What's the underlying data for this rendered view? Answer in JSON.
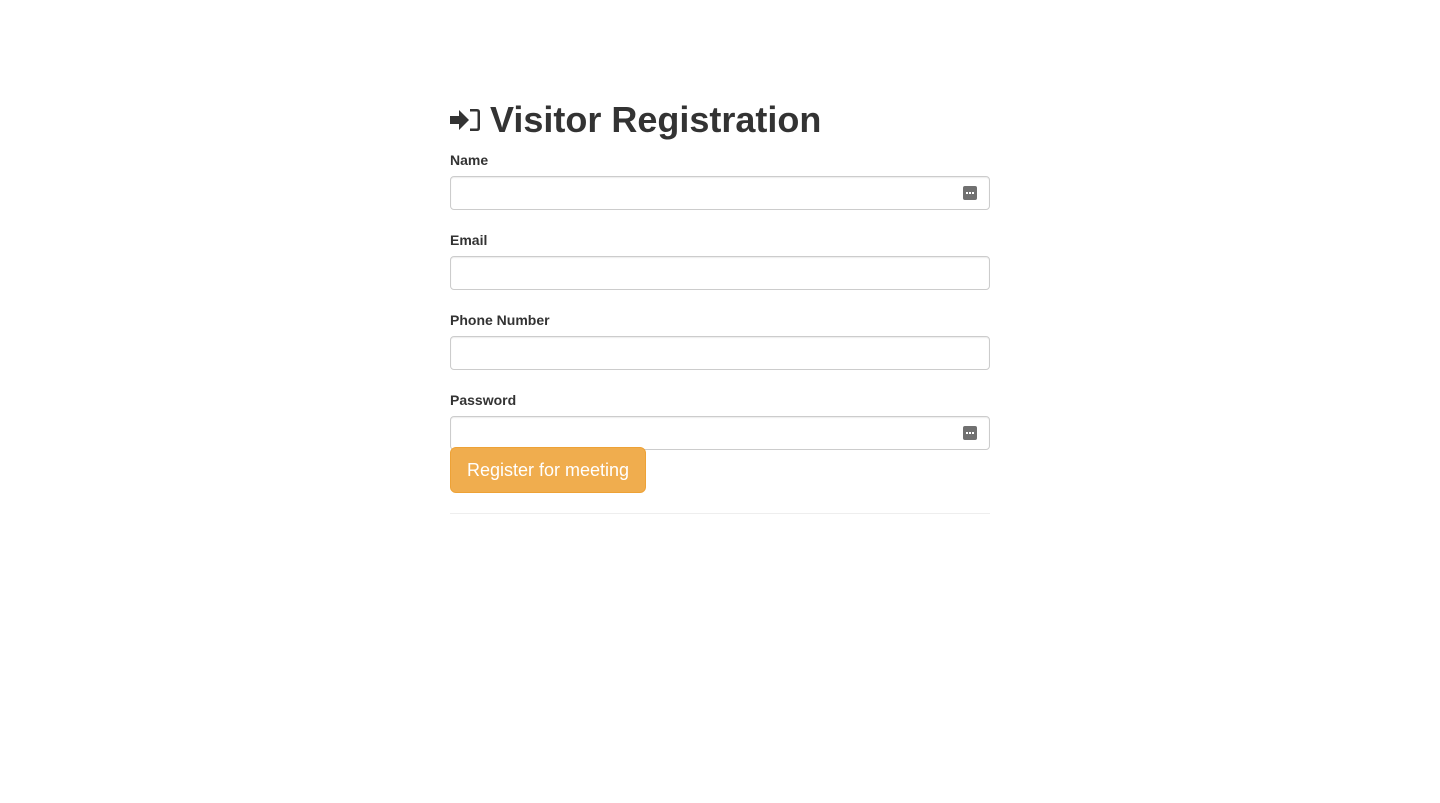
{
  "header": {
    "icon": "sign-in-icon",
    "title": "Visitor Registration"
  },
  "form": {
    "fields": [
      {
        "label": "Name",
        "value": "",
        "type": "text",
        "has_autofill_icon": true
      },
      {
        "label": "Email",
        "value": "",
        "type": "email",
        "has_autofill_icon": false
      },
      {
        "label": "Phone Number",
        "value": "",
        "type": "tel",
        "has_autofill_icon": false
      },
      {
        "label": "Password",
        "value": "",
        "type": "password",
        "has_autofill_icon": true
      }
    ],
    "submit_label": "Register for meeting"
  },
  "colors": {
    "button_background": "#f0ad4e",
    "button_border": "#eea236",
    "text": "#333333",
    "input_border": "#cccccc"
  }
}
